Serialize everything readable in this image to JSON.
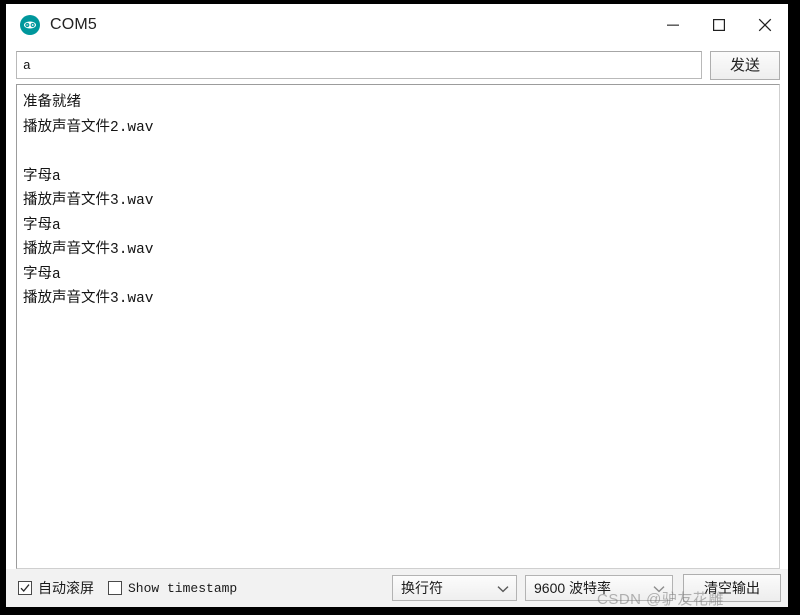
{
  "window": {
    "title": "COM5",
    "icon": "arduino-logo-icon",
    "accent_color": "#00979c",
    "controls": {
      "minimize": "—",
      "maximize": "□",
      "close": "✕"
    }
  },
  "send_row": {
    "input_value": "a",
    "input_placeholder": "",
    "send_label": "发送"
  },
  "console": {
    "lines": [
      "准备就绪",
      "播放声音文件2.wav",
      "",
      "字母a",
      "播放声音文件3.wav",
      "字母a",
      "播放声音文件3.wav",
      "字母a",
      "播放声音文件3.wav"
    ]
  },
  "status_bar": {
    "autoscroll_label": "自动滚屏",
    "autoscroll_checked": true,
    "timestamp_label": "Show timestamp",
    "timestamp_checked": false,
    "line_ending_selected": "换行符",
    "baud_rate_selected": "9600 波特率",
    "clear_output_label": "清空输出"
  },
  "watermark": {
    "text": "CSDN @驴友花雕"
  }
}
